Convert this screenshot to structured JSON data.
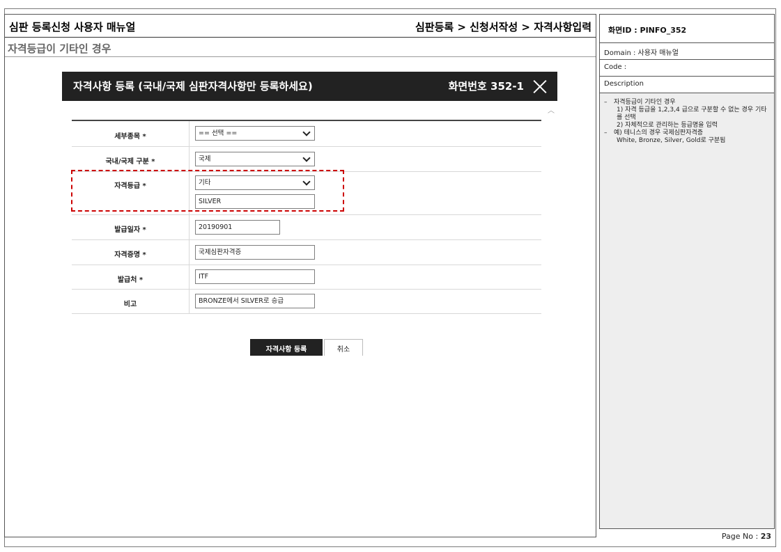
{
  "header": {
    "title": "심판 등록신청 사용자 매뉴얼",
    "path": "심판등록 > 신청서작성 > 자격사항입력"
  },
  "subtitle": "자격등급이 기타인 경우",
  "dialog": {
    "title": "자격사항 등록 (국내/국제 심판자격사항만 등록하세요)",
    "screen_no": "화면번호 352-1",
    "fields": {
      "detail_type": {
        "label": "세부종목 *",
        "value": "== 선택 =="
      },
      "domestic_intl": {
        "label": "국내/국제 구분 *",
        "value": "국제"
      },
      "grade": {
        "label": "자격등급 *",
        "value": "기타",
        "custom_value": "SILVER"
      },
      "issue_date": {
        "label": "발급일자 *",
        "value": "20190901"
      },
      "cert_name": {
        "label": "자격증명 *",
        "value": "국제심판자격증"
      },
      "issuer": {
        "label": "발급처 *",
        "value": "ITF"
      },
      "remarks": {
        "label": "비고",
        "value": "BRONZE에서 SILVER로 승급"
      }
    },
    "buttons": {
      "register": "자격사항 등록",
      "cancel": "취소"
    }
  },
  "side": {
    "screen_id": "화면ID : PINFO_352",
    "domain": "Domain : 사용자 매뉴얼",
    "code": "Code :",
    "description_label": "Description",
    "description": [
      [
        "자격등급이 기타인 경우",
        "1) 자격 등급을 1,2,3,4 급으로 구분할 수 없는 경우 기타를 선택",
        "2) 자체적으로 관리하는 등급명을 입력"
      ],
      [
        "예) 테니스의 경우 국제심판자격증",
        "White, Bronze, Silver, Gold로 구분됨"
      ]
    ]
  },
  "page": {
    "label": "Page No :",
    "number": "23"
  }
}
